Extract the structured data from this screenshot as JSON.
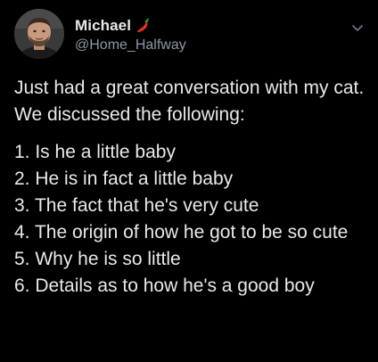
{
  "author": {
    "display_name": "Michael",
    "handle": "@Home_Halfway",
    "avatar_icon": "profile-photo",
    "name_emoji_icon": "hot-pepper-icon"
  },
  "tweet": {
    "intro": "Just had a great conversation with my cat. We discussed the following:",
    "list": [
      "1. Is he a little baby",
      "2. He is in fact a little baby",
      "3. The fact that he's very cute",
      "4. The origin of how he got to be so cute",
      "5. Why he is so little",
      "6. Details as to how he's a good boy"
    ]
  },
  "colors": {
    "background": "#000000",
    "text": "#e7e9ea",
    "secondary_text": "#8b98a5",
    "pepper": "#e0312b"
  }
}
